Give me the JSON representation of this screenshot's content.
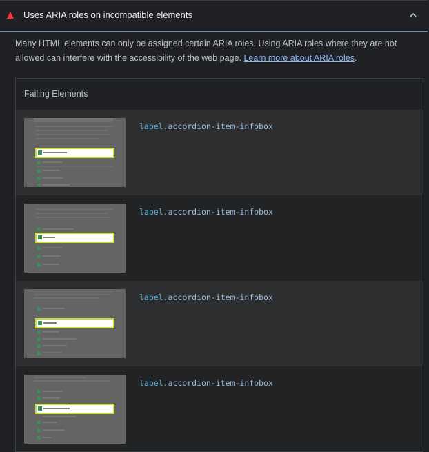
{
  "audit": {
    "title": "Uses ARIA roles on incompatible elements",
    "description": "Many HTML elements can only be assigned certain ARIA roles. Using ARIA roles where they are not allowed can interfere with the accessibility of the web page. ",
    "learn_more": "Learn more about ARIA roles",
    "period": ".",
    "status_color": "#ff3333",
    "accent_color": "#5e86c4"
  },
  "table": {
    "header": "Failing Elements",
    "rows": [
      {
        "tag": "label",
        "selector": ".accordion-item-infobox"
      },
      {
        "tag": "label",
        "selector": ".accordion-item-infobox"
      },
      {
        "tag": "label",
        "selector": ".accordion-item-infobox"
      },
      {
        "tag": "label",
        "selector": ".accordion-item-infobox"
      }
    ]
  },
  "icons": {
    "status": "fail-triangle-icon",
    "collapse": "chevron-up-icon"
  }
}
